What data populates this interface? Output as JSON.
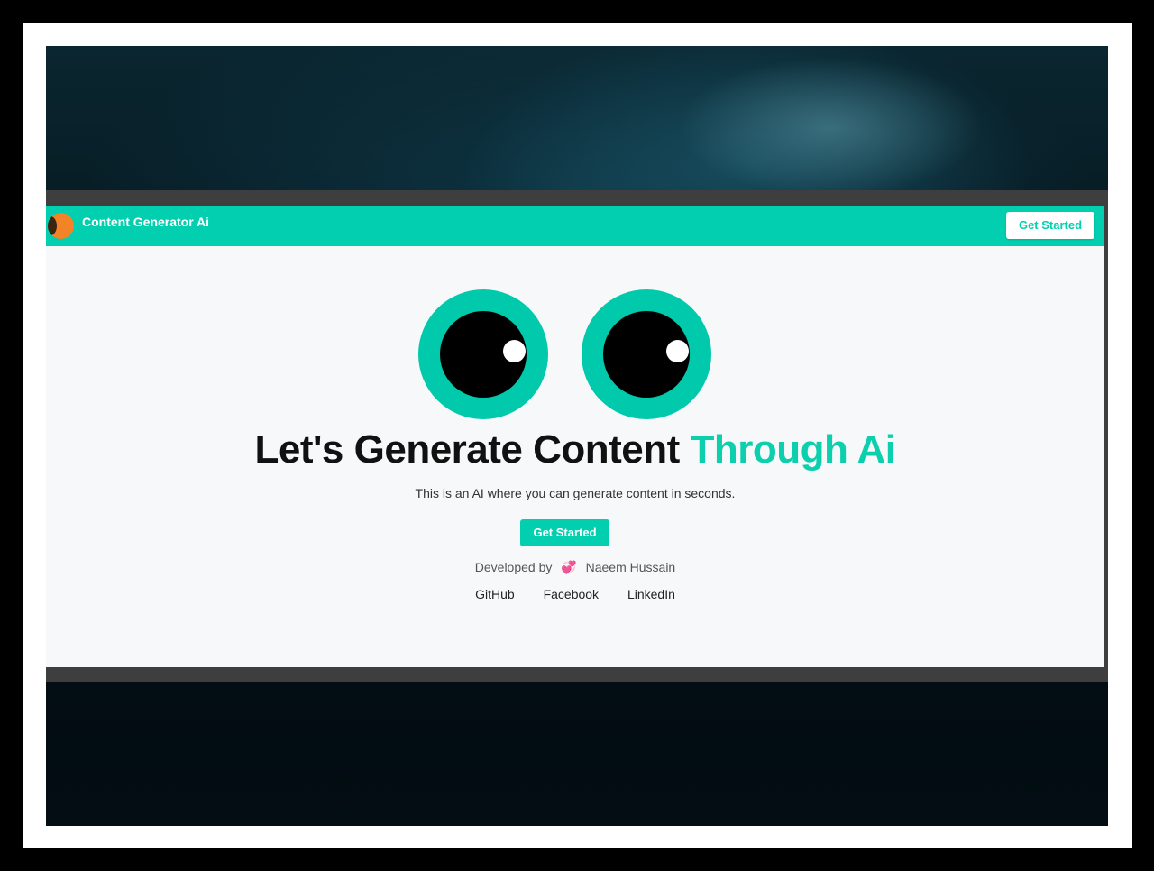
{
  "navbar": {
    "brand": "Content Generator Ai",
    "cta_label": "Get Started"
  },
  "hero": {
    "headline_main": "Let's Generate Content",
    "headline_accent": "Through Ai",
    "subtitle": "This is an AI where you can generate content in seconds.",
    "cta_label": "Get Started"
  },
  "credits": {
    "prefix": "Developed by",
    "heart": "💞",
    "author": "Naeem Hussain"
  },
  "links": [
    "GitHub",
    "Facebook",
    "LinkedIn"
  ],
  "colors": {
    "accent": "#01cfb0",
    "background": "#f6f8fa",
    "text": "#111111"
  },
  "icons": {
    "logo": "half-moon-logo-icon",
    "heart": "heart-icon",
    "eyes": "cartoon-eyes-icon"
  }
}
